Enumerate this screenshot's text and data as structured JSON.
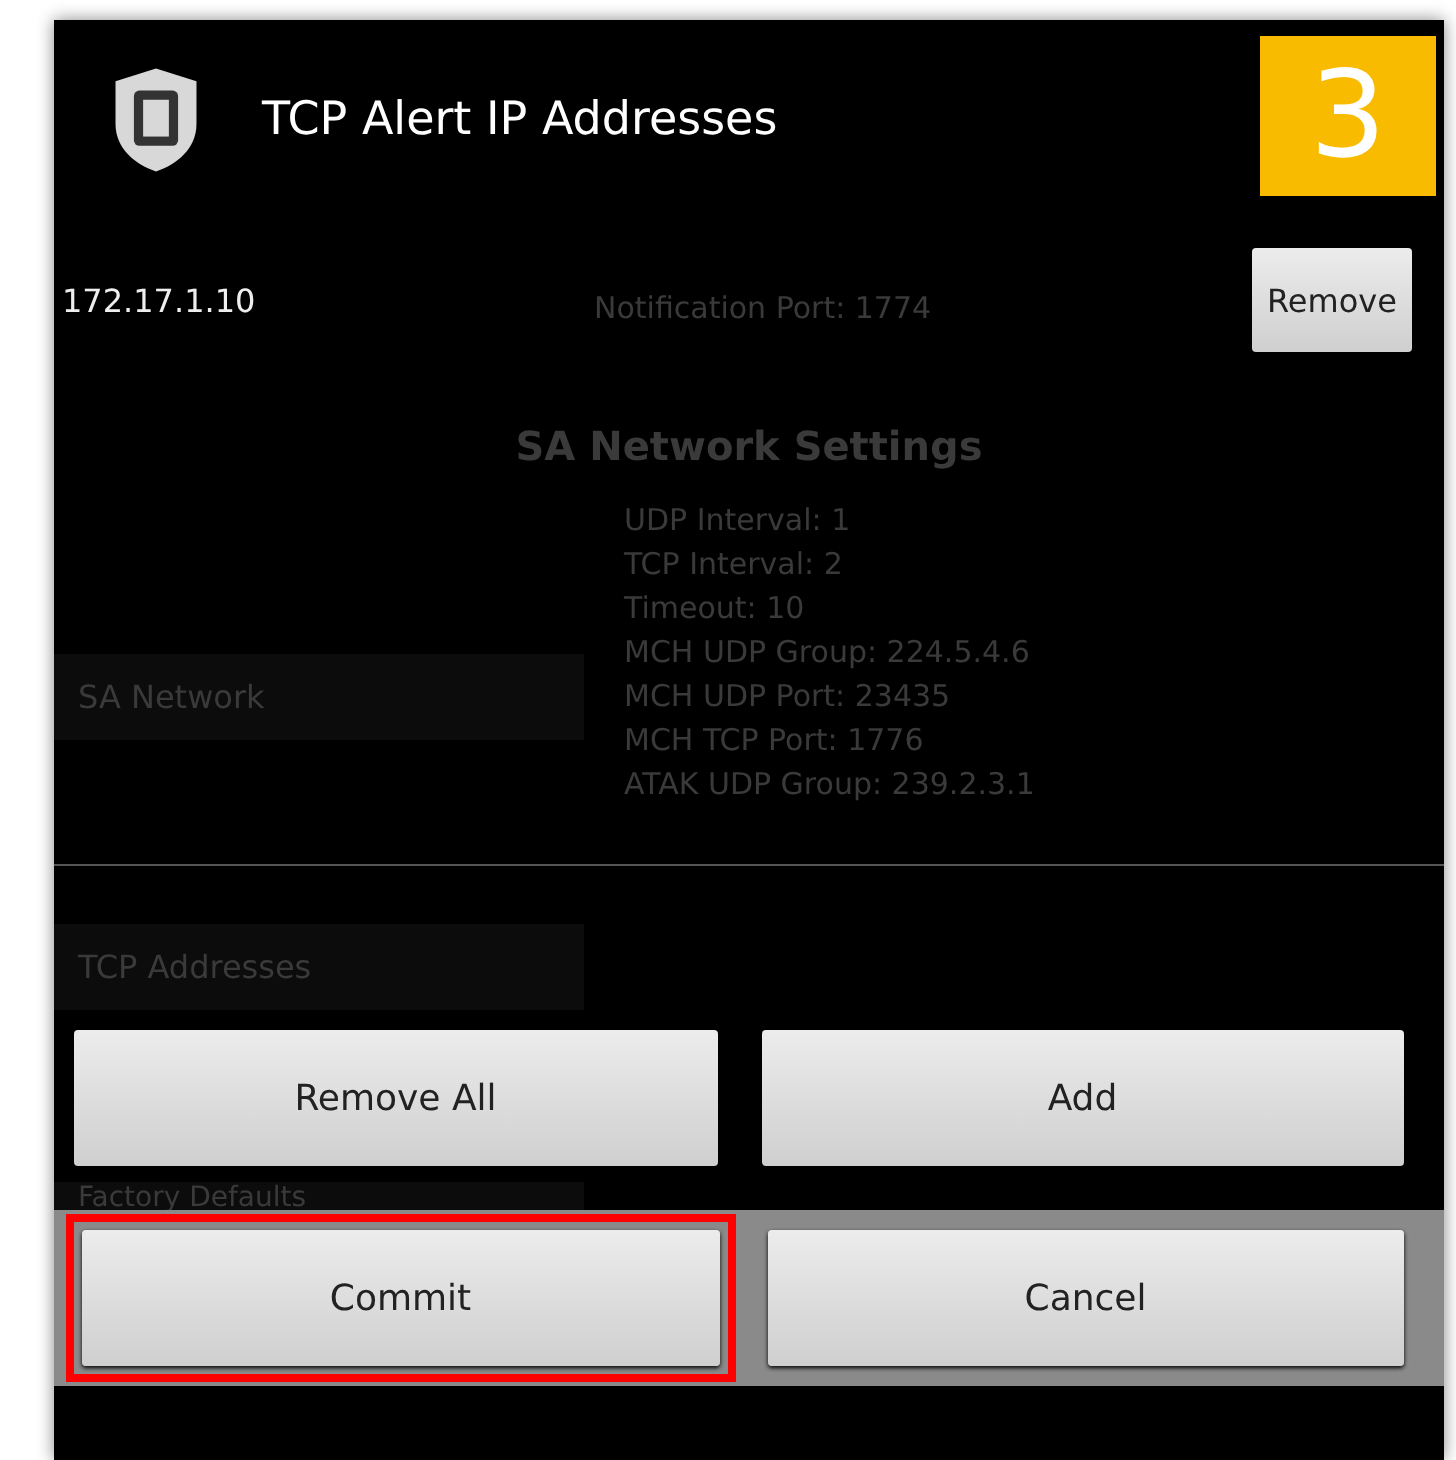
{
  "step_badge": "3",
  "background": {
    "notification_line": "Notification Port: 1774",
    "section_title": "SA Network Settings",
    "menu": [
      "SA Network",
      "TCP Addresses",
      "Factory Defaults"
    ],
    "info_lines": [
      "UDP Interval: 1",
      "TCP Interval: 2",
      "Timeout: 10",
      "MCH UDP Group: 224.5.4.6",
      "MCH UDP Port: 23435",
      "MCH TCP Port: 1776",
      "ATAK UDP Group: 239.2.3.1"
    ]
  },
  "dialog": {
    "title": "TCP Alert IP Addresses",
    "addresses": [
      {
        "ip": "172.17.1.10",
        "action": "Remove"
      }
    ],
    "buttons": [
      {
        "label": "Remove All",
        "highlighted": false
      },
      {
        "label": "Add",
        "highlighted": false
      },
      {
        "label": "Commit",
        "highlighted": true
      },
      {
        "label": "Cancel",
        "highlighted": false
      }
    ]
  }
}
